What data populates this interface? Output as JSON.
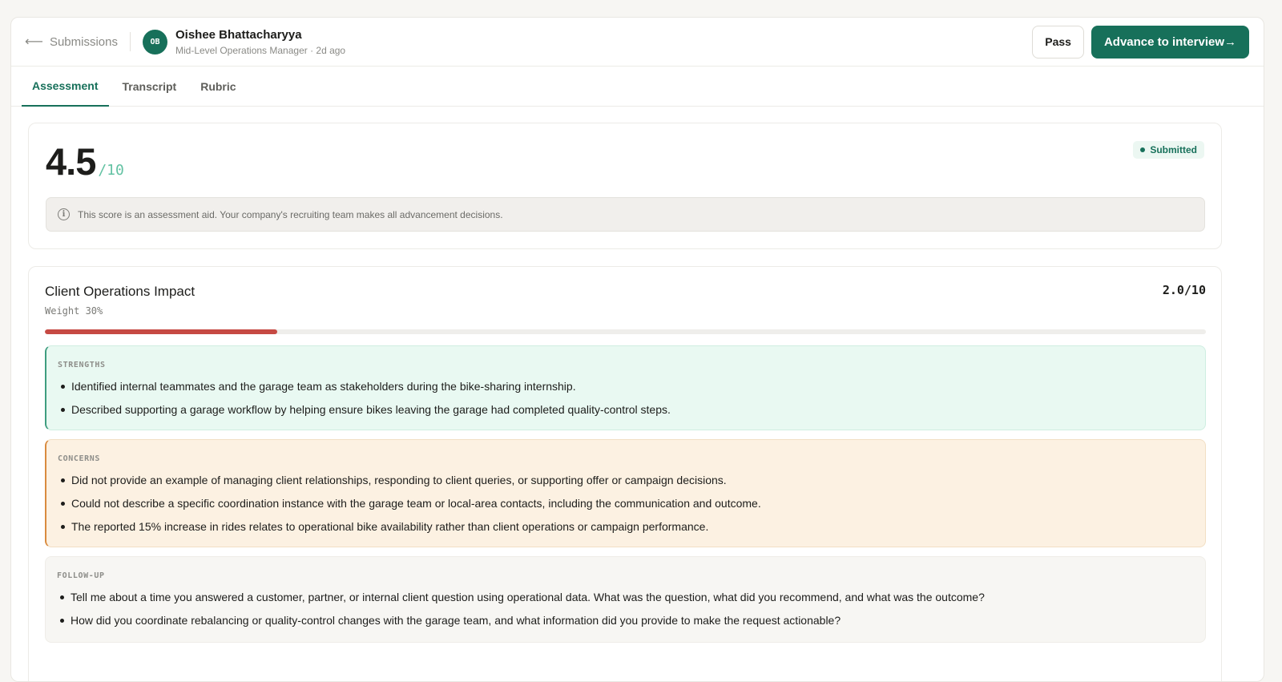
{
  "header": {
    "back_label": "Submissions",
    "avatar_initials": "OB",
    "candidate_name": "Oishee Bhattacharyya",
    "candidate_meta": "Mid-Level Operations Manager · 2d ago",
    "pass_label": "Pass",
    "advance_label": "Advance to interview→"
  },
  "tabs": [
    {
      "label": "Assessment",
      "active": true
    },
    {
      "label": "Transcript",
      "active": false
    },
    {
      "label": "Rubric",
      "active": false
    }
  ],
  "summary": {
    "score": "4.5",
    "out_of": "/10",
    "status": "Submitted",
    "notice": "This score is an assessment aid. Your company's recruiting team makes all advancement decisions."
  },
  "criterion": {
    "title": "Client Operations Impact",
    "weight": "Weight 30%",
    "score_text": "2.0/10",
    "score_fraction": 0.2,
    "strengths_label": "STRENGTHS",
    "strengths": [
      "Identified internal teammates and the garage team as stakeholders during the bike-sharing internship.",
      "Described supporting a garage workflow by helping ensure bikes leaving the garage had completed quality-control steps."
    ],
    "concerns_label": "CONCERNS",
    "concerns": [
      "Did not provide an example of managing client relationships, responding to client queries, or supporting offer or campaign decisions.",
      "Could not describe a specific coordination instance with the garage team or local-area contacts, including the communication and outcome.",
      "The reported 15% increase in rides relates to operational bike availability rather than client operations or campaign performance."
    ],
    "followup_label": "FOLLOW-UP",
    "followup": [
      "Tell me about a time you answered a customer, partner, or internal client question using operational data. What was the question, what did you recommend, and what was the outcome?",
      "How did you coordinate rebalancing or quality-control changes with the garage team, and what information did you provide to make the request actionable?"
    ]
  },
  "colors": {
    "brand": "#17705a",
    "score_bar": "#c64a43",
    "strengths_bg": "#e9f9f2",
    "concerns_bg": "#fcf1e2"
  },
  "icons": {
    "back": "arrow-left-icon",
    "notice": "info-icon",
    "status": "dot-icon"
  }
}
